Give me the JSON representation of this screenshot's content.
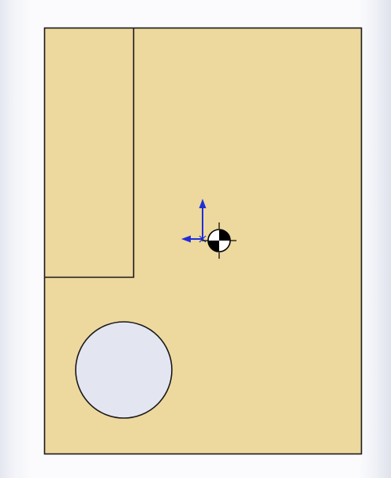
{
  "viewport": {
    "background_color": "#f4f5fa"
  },
  "part": {
    "face_color": "#edd89e",
    "edge_color": "#1a1a1a",
    "hole_fill_color": "#e3e6f0"
  },
  "triad": {
    "axis_color": "#1f2fd6"
  },
  "center_of_mass": {
    "light_color": "#ffffff",
    "dark_color": "#000000"
  }
}
